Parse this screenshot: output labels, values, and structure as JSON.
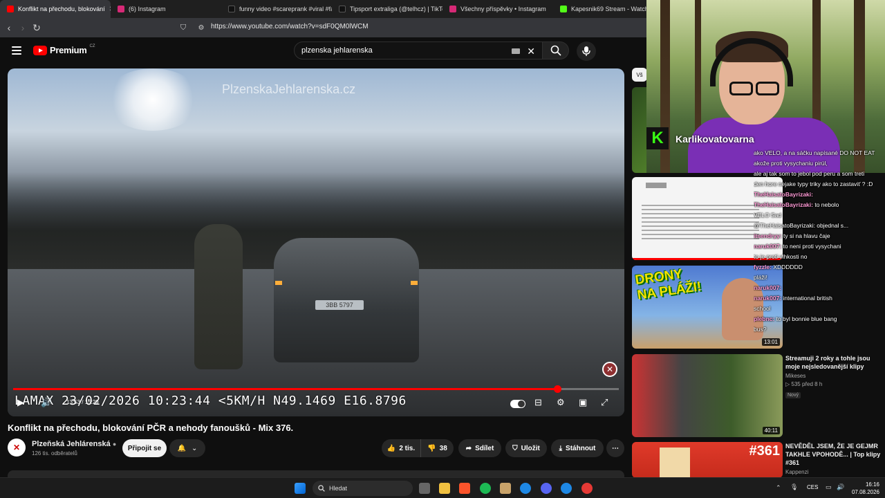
{
  "browser": {
    "tabs": [
      {
        "label": "Konflikt na přechodu, blokování",
        "active": true,
        "color": "#ff0000"
      },
      {
        "label": "(6) Instagram",
        "color": "#d62976"
      },
      {
        "label": "funny video #scareprank #viral #fa",
        "color": "#111111"
      },
      {
        "label": "Tipsport extraliga (@telhcz) | TikTok",
        "color": "#111111"
      },
      {
        "label": "Všechny příspěvky • Instagram",
        "color": "#d62976"
      },
      {
        "label": "Kapesnik69 Stream - Watch",
        "color": "#53fc18"
      }
    ],
    "url": "https://www.youtube.com/watch?v=sdF0QM0lWCM"
  },
  "youtube": {
    "logo": "Premium",
    "region": "CZ",
    "search_value": "plzenska jehlarenska",
    "player": {
      "watermark": "PlzenskaJehlarenska.cz",
      "osd": "LAMAX 23/02/2026 10:23:44 <5KM/H N49.1469 E16.8796",
      "plate": "3BB 5797",
      "time_current": "13:53",
      "time_total": "15:29",
      "progress": 0.9
    },
    "video": {
      "title": "Konflikt na přechodu, blokování PČR a nehody fanoušků - Mix 376.",
      "channel": "Plzeňská Jehlárenská",
      "subscribers": "126 tis. odběratelů",
      "subscribe": "Připojit se",
      "likes": "2 tis.",
      "dislikes": "38",
      "share": "Sdílet",
      "save": "Uložit",
      "download": "Stáhnout"
    },
    "sidebar": {
      "chip": "Vš",
      "videos": [
        {
          "title": "",
          "meta": "",
          "duration": ""
        },
        {
          "title": "",
          "meta": "",
          "duration": ""
        },
        {
          "title": "DRONY NA PLÁŽI!",
          "meta": "",
          "duration": "13:01"
        },
        {
          "title": "Streamuji 2 roky a tohle jsou moje nejsledovanější klipy",
          "channel": "Mikeses",
          "meta": "535 před 8 h",
          "badge": "Nový",
          "duration": "40:11"
        },
        {
          "title": "NEVĚDĚL JSEM, ŽE JE GEJMR TAKHLE VPOHODĚ... | Top klipy #361",
          "channel": "Kappenzi",
          "thumb_text": "#361"
        }
      ]
    }
  },
  "stream": {
    "streamer": "Karlikovatovarna",
    "chat": [
      {
        "user": "",
        "text": "ako VELO, a na sáčku napísané DO NOT EAT"
      },
      {
        "user": "",
        "text": "akože proti vysychaniu pirúl,"
      },
      {
        "user": "",
        "text": "ale aj tak som to jebol pod peru a som treti"
      },
      {
        "user": "",
        "text": "den hore nejake typy triky ako to zastaviť ? :D"
      },
      {
        "user": "TheHaisatoBayrizaki:",
        "text": ""
      },
      {
        "user": "TheHaisatoBayrizaki:",
        "text": "to nebolo"
      },
      {
        "user": "",
        "text": "VELO Sad"
      },
      {
        "user": "",
        "text": "@TheHaisatoBayrizaki: objednal s..."
      },
      {
        "user": "itsendryy:",
        "text": "ty si na hlavu čaje"
      },
      {
        "user": "naruk007:",
        "text": "to neni proti vysychani"
      },
      {
        "user": "",
        "text": "to je proti vlhkosti no"
      },
      {
        "user": "fyzzle:",
        "text": "XDDDDDD"
      },
      {
        "user": "",
        "text": "pláži!"
      },
      {
        "user": "naruk007:",
        "text": ""
      },
      {
        "user": "naruk007:",
        "text": "international british"
      },
      {
        "user": "",
        "text": "school"
      },
      {
        "user": "plebnc:",
        "text": "to byl bonnie blue bang"
      },
      {
        "user": "",
        "text": "bus?"
      }
    ]
  },
  "taskbar": {
    "search": "Hledat",
    "lang": "CES",
    "time": "16:16",
    "date": "07.08.2026"
  }
}
